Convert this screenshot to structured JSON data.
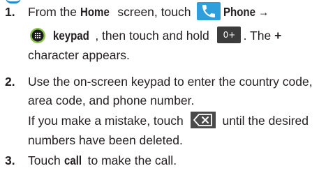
{
  "steps": [
    {
      "number": "1.",
      "line1_pre": "From the ",
      "home": "Home",
      "line1_mid": " screen, touch ",
      "phone": "Phone →",
      "line2_keypad": "keypad",
      "line2_mid": ", then touch and hold ",
      "key_label": "0+",
      "line2_post": ". The ",
      "plus": "+",
      "line3": "character appears."
    },
    {
      "number": "2.",
      "line1": "Use the on-screen keypad to enter the country code,",
      "line2": "area code, and phone number.",
      "line3_pre": "If you make a mistake, touch ",
      "line3_post": " until the desired",
      "line4": "numbers have been deleted."
    },
    {
      "number": "3.",
      "line1_pre": "Touch ",
      "call": "call",
      "line1_post": " to make the call."
    }
  ],
  "icons": {
    "phone": "phone-app-icon",
    "keypad": "keypad-icon",
    "key_zero": "zero-plus-key-icon",
    "delete": "backspace-delete-icon"
  },
  "colors": {
    "text": "#231f20",
    "phone_icon_bg": "#2e9fdb",
    "keypad_ring": "#8bc34a",
    "keypad_center": "#1b1b1b",
    "key_bg": "#3c3c3c",
    "delete_bg": "#4a4a4a"
  }
}
